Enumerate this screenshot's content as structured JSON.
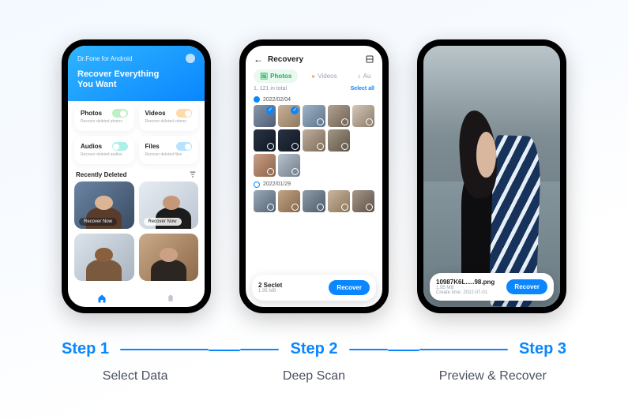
{
  "phone1": {
    "brand": "Dr.Fone for Android",
    "title_line1": "Recover Everything",
    "title_line2": "You Want",
    "cards": {
      "photos": {
        "label": "Photos",
        "sub": "Recover deleted photos"
      },
      "videos": {
        "label": "Videos",
        "sub": "Recover deleted videos"
      },
      "audios": {
        "label": "Audios",
        "sub": "Recover deleted audios"
      },
      "files": {
        "label": "Files",
        "sub": "Recover deleted files"
      }
    },
    "recent_section": "Recently Deleted",
    "recover_now": "Recover Now"
  },
  "phone2": {
    "back": "←",
    "title": "Recovery",
    "tabs": {
      "photos": "Photos",
      "videos": "Videos",
      "audios": "Au"
    },
    "total": "1, 121 in total",
    "select_all": "Select all",
    "date1": "2022/02/04",
    "date2": "2022/01/29",
    "selected_label": "2 Seclet",
    "selected_sub": "1.95 MB",
    "recover": "Recover"
  },
  "phone3": {
    "filename": "10987K6L.....98.png",
    "filesize": "1.95 MB",
    "created": "Create time: 2022-07-01",
    "recover": "Recover"
  },
  "steps": {
    "s1_title": "Step 1",
    "s1_sub": "Select Data",
    "s2_title": "Step 2",
    "s2_sub": "Deep Scan",
    "s3_title": "Step 3",
    "s3_sub": "Preview & Recover"
  }
}
